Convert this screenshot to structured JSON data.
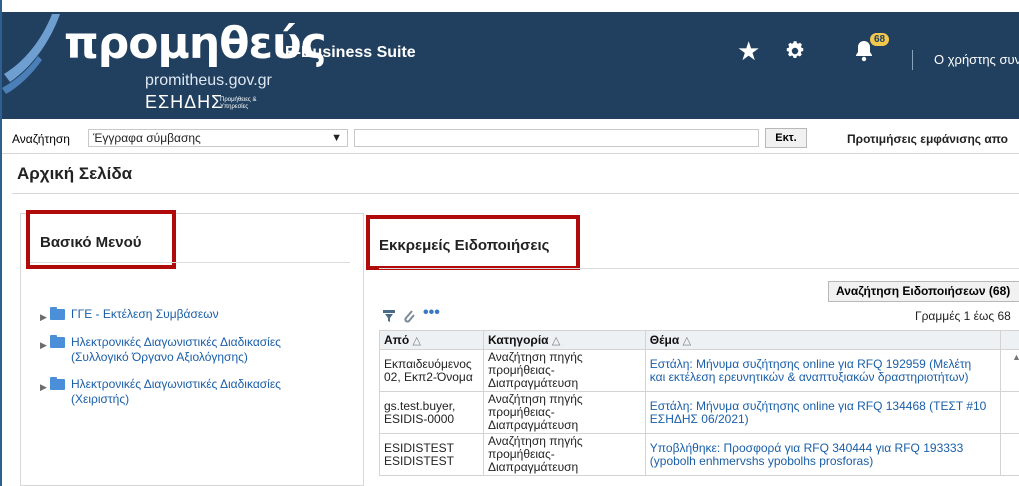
{
  "header": {
    "logo_main": "προμηθεύς",
    "logo_sub": "promitheus.gov.gr",
    "logo_esidis": "ΕΣΗΔΗΣ",
    "logo_tiny": "Προμήθειες & Υπηρεσίες",
    "app_name": "E-Business Suite",
    "notifications_count": "68",
    "user_text": "Ο χρήστης συνδ",
    "favorites_icon": "star-icon",
    "settings_icon": "gear-icon",
    "notifications_icon": "bell-icon"
  },
  "search": {
    "label": "Αναζήτηση",
    "selected_option": "Έγγραφα σύμβασης",
    "query": "",
    "go_label": "Εκτ.",
    "preferences_link": "Προτιμήσεις εμφάνισης απο"
  },
  "page": {
    "title": "Αρχική Σελίδα"
  },
  "main_menu": {
    "heading": "Βασικό Μενού",
    "items": [
      {
        "label_line1": "ΓΓΕ - Εκτέλεση Συμβάσεων",
        "label_line2": ""
      },
      {
        "label_line1": "Ηλεκτρονικές Διαγωνιστικές Διαδικασίες",
        "label_line2": "(Συλλογικό Όργανο Αξιολόγησης)"
      },
      {
        "label_line1": "Ηλεκτρονικές Διαγωνιστικές Διαδικασίες",
        "label_line2": "(Χειριστής)"
      }
    ]
  },
  "notifications": {
    "heading": "Εκκρεμείς Ειδοποιήσεις",
    "search_button": "Αναζήτηση Ειδοποιήσεων (68)",
    "rows_info": "Γραμμές 1 έως 68",
    "columns": [
      "Από",
      "Κατηγορία",
      "Θέμα"
    ],
    "rows": [
      {
        "from_1": "Εκπαιδευόμενος",
        "from_2": "02, Εκπ2-Όνομα",
        "category_1": "Αναζήτηση πηγής",
        "category_2": "προμήθειας-",
        "category_3": "Διαπραγμάτευση",
        "subject_1": "Εστάλη: Μήνυμα συζήτησης online για RFQ 192959 (Μελέτη",
        "subject_2": "και εκτέλεση ερευνητικών & αναπτυξιακών δραστηριοτήτων)"
      },
      {
        "from_1": "gs.test.buyer,",
        "from_2": "ESIDIS-0000",
        "category_1": "Αναζήτηση πηγής",
        "category_2": "προμήθειας-",
        "category_3": "Διαπραγμάτευση",
        "subject_1": "Εστάλη: Μήνυμα συζήτησης online για RFQ 134468 (ΤΕΣΤ #10",
        "subject_2": "ΕΣΗΔΗΣ 06/2021)"
      },
      {
        "from_1": "ESIDISTEST",
        "from_2": "ESIDISTEST",
        "category_1": "Αναζήτηση πηγής",
        "category_2": "προμήθειας-",
        "category_3": "Διαπραγμάτευση",
        "subject_1": "Υποβλήθηκε: Προσφορά για RFQ 340444 για RFQ 193333",
        "subject_2": "(ypobolh enhmervshs ypobolhs prosforas)"
      }
    ]
  }
}
